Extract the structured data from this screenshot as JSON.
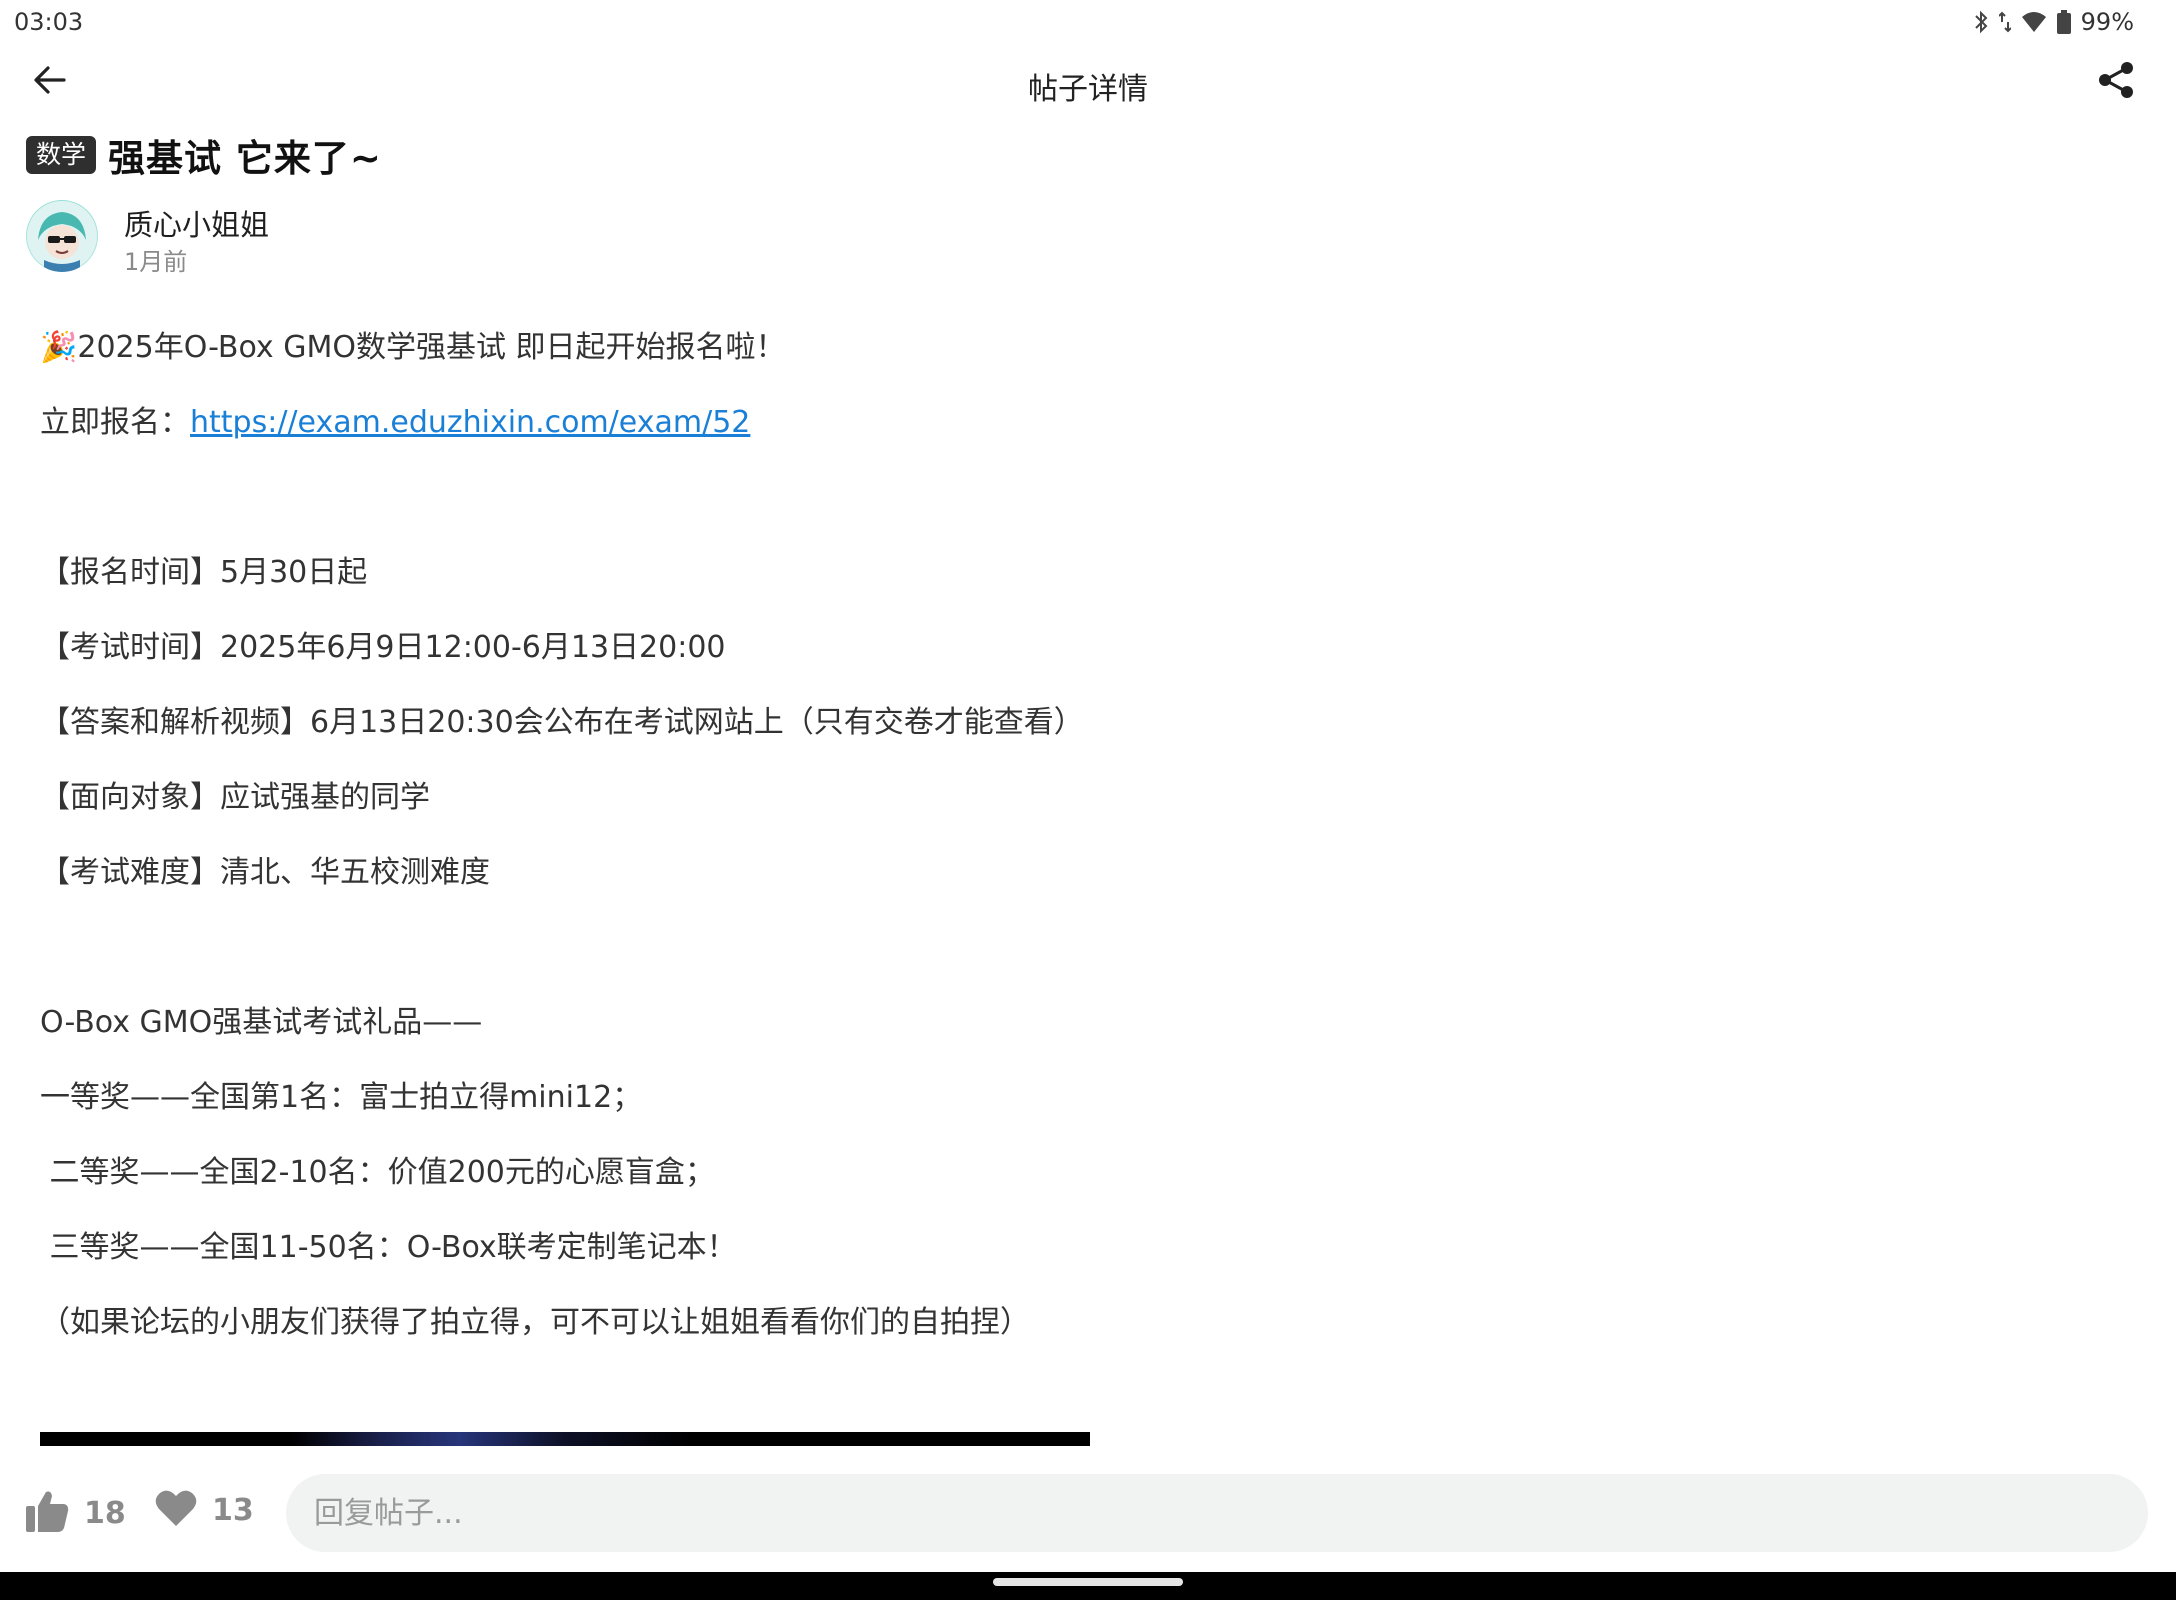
{
  "status_bar": {
    "time": "03:03",
    "battery": "99%",
    "icons": [
      "bluetooth-icon",
      "data-arrows-icon",
      "wifi-icon",
      "battery-icon"
    ]
  },
  "app_bar": {
    "title": "帖子详情",
    "icons": [
      "back-arrow-icon",
      "share-icon"
    ]
  },
  "post": {
    "category": "数学",
    "title": "强基试  它来了~",
    "author": "质心小姐姐",
    "time": "1月前",
    "body": [
      {
        "text": "🎉2025年O-Box GMO数学强基试 即日起开始报名啦！"
      },
      {
        "text": "立即报名：",
        "link": "https://exam.eduzhixin.com/exam/52"
      },
      {
        "text": ""
      },
      {
        "text": "【报名时间】5月30日起"
      },
      {
        "text": "【考试时间】2025年6月9日12:00-6月13日20:00"
      },
      {
        "text": "【答案和解析视频】6月13日20:30会公布在考试网站上（只有交卷才能查看）"
      },
      {
        "text": "【面向对象】应试强基的同学"
      },
      {
        "text": "【考试难度】清北、华五校测难度"
      },
      {
        "text": ""
      },
      {
        "text": "O-Box GMO强基试考试礼品——"
      },
      {
        "text": "一等奖——全国第1名：富士拍立得mini12；"
      },
      {
        "text": " 二等奖——全国2-10名：价值200元的心愿盲盒；"
      },
      {
        "text": " 三等奖——全国11-50名：O-Box联考定制笔记本！"
      },
      {
        "text": "（如果论坛的小朋友们获得了拍立得，可不可以让姐姐看看你们的自拍捏）"
      }
    ]
  },
  "actions": {
    "like_count": "18",
    "favorite_count": "13",
    "reply_placeholder": "回复帖子..."
  },
  "colors": {
    "link": "#1a7fd6",
    "badge_bg": "#2f2f2f",
    "reply_bg": "#f1f2f2",
    "muted": "#8a8a8a"
  }
}
